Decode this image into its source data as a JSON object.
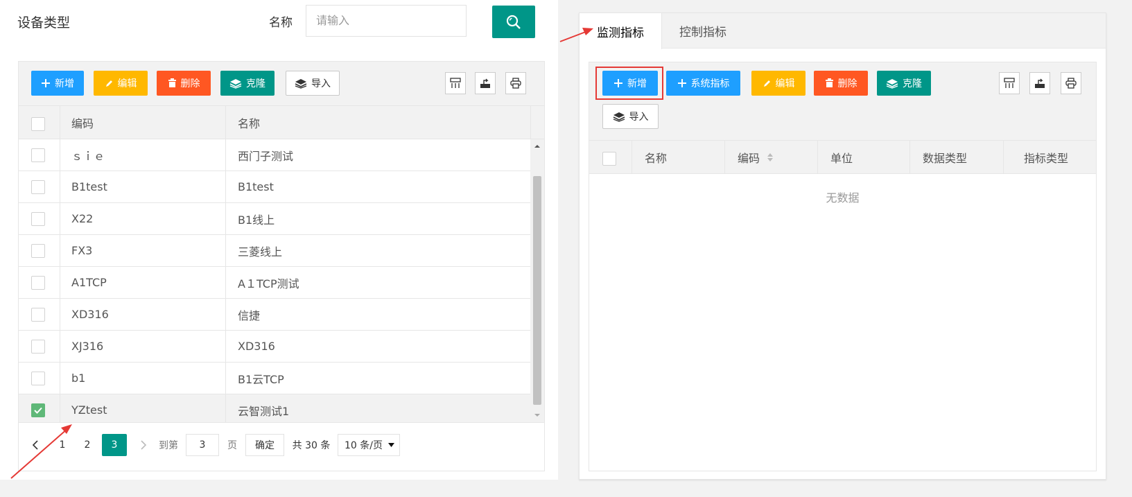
{
  "left": {
    "title": "设备类型",
    "search": {
      "label": "名称",
      "placeholder": "请输入"
    },
    "toolbar": {
      "add": "新增",
      "edit": "编辑",
      "delete": "删除",
      "clone": "克隆",
      "import": "导入"
    },
    "columns": [
      "编码",
      "名称"
    ],
    "rows": [
      {
        "code": "ｓｉｅ",
        "name": "西门子测试",
        "checked": false
      },
      {
        "code": "B1test",
        "name": "B1test",
        "checked": false
      },
      {
        "code": "X22",
        "name": "B1线上",
        "checked": false
      },
      {
        "code": "FX3",
        "name": "三菱线上",
        "checked": false
      },
      {
        "code": "A1TCP",
        "name": "A１TCP测试",
        "checked": false
      },
      {
        "code": "XD316",
        "name": "信捷",
        "checked": false
      },
      {
        "code": "XJ316",
        "name": "XD316",
        "checked": false
      },
      {
        "code": "b1",
        "name": "B1云TCP",
        "checked": false
      },
      {
        "code": "YZtest",
        "name": "云智测试1",
        "checked": true
      }
    ],
    "pager": {
      "pages": [
        "1",
        "2",
        "3"
      ],
      "current": "3",
      "goto_label": "到第",
      "goto_value": "3",
      "page_unit": "页",
      "confirm": "确定",
      "total": "共 30 条",
      "page_size": "10 条/页"
    }
  },
  "right": {
    "tabs": [
      "监测指标",
      "控制指标"
    ],
    "active_tab": "监测指标",
    "toolbar": {
      "add": "新增",
      "system": "系统指标",
      "edit": "编辑",
      "delete": "删除",
      "clone": "克隆",
      "import": "导入"
    },
    "columns": [
      "名称",
      "编码",
      "单位",
      "数据类型",
      "指标类型"
    ],
    "empty_text": "无数据"
  },
  "colors": {
    "primary_green": "#009688",
    "blue": "#1e9fff",
    "yellow": "#ffb800",
    "red": "#ff5722",
    "check_green": "#5fb878",
    "annotation_red": "#e53935"
  },
  "icons": [
    "search-icon",
    "plus-icon",
    "pencil-icon",
    "trash-icon",
    "layers-icon",
    "columns-icon",
    "export-icon",
    "print-icon",
    "chevron-left-icon",
    "chevron-right-icon",
    "sort-icon",
    "caret-down-icon"
  ]
}
